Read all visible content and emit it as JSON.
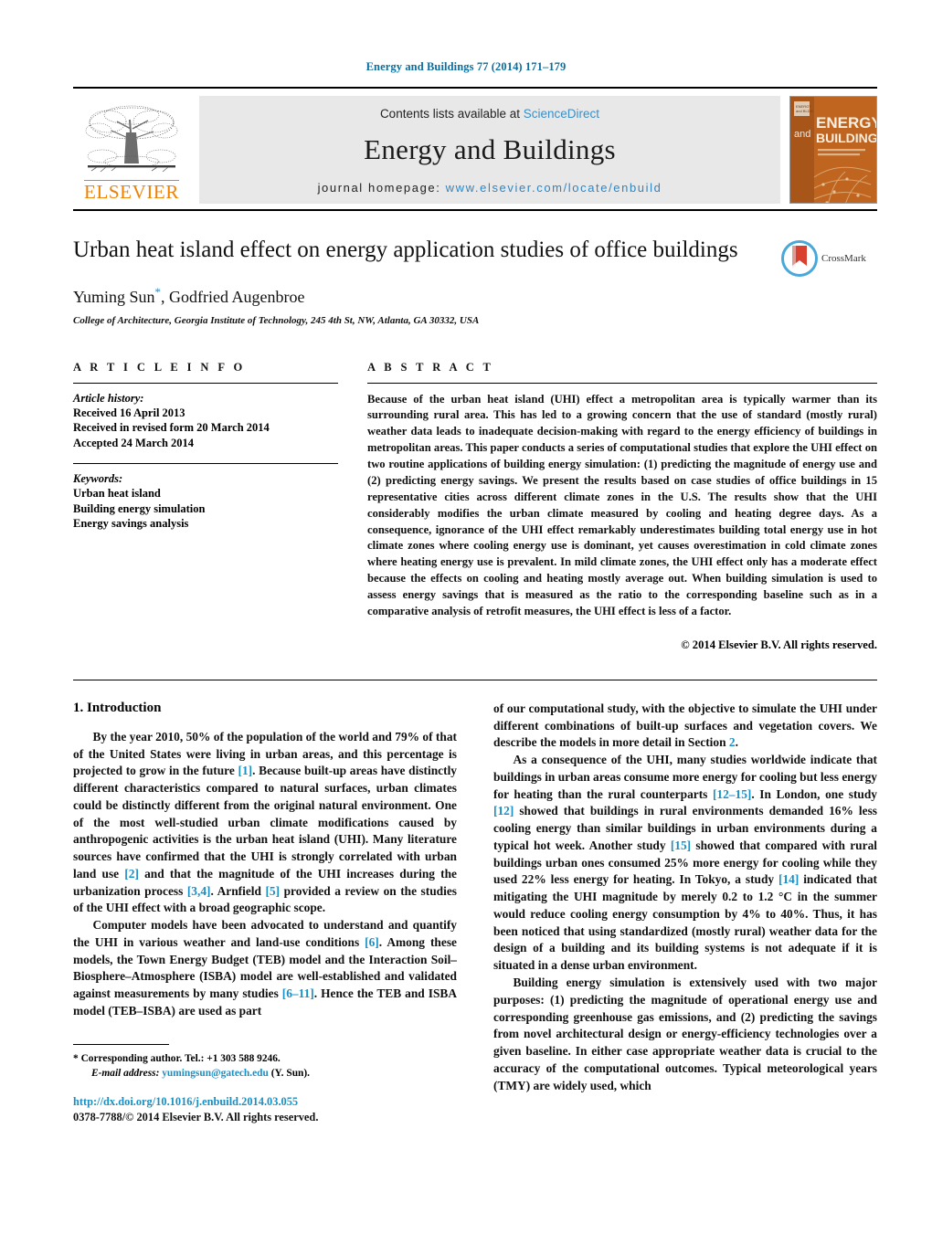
{
  "running_head": "Energy and Buildings 77 (2014) 171–179",
  "masthead": {
    "publisher_name": "ELSEVIER",
    "contents_prefix": "Contents lists available at ",
    "contents_link": "ScienceDirect",
    "journal_name": "Energy and Buildings",
    "homepage_prefix": "journal homepage: ",
    "homepage_url": "www.elsevier.com/locate/enbuild",
    "cover": {
      "line_and": "and",
      "line_energy": "ENERGY",
      "line_buildings": "BUILDINGS"
    },
    "accent_link_color": "#3a8fc7",
    "elsevier_orange": "#f08000",
    "cover_color": "#c0651f"
  },
  "article": {
    "title": "Urban heat island effect on energy application studies of office buildings",
    "authors": "Yuming Sun",
    "authors_rest": ", Godfried Augenbroe",
    "corresponding_marker": "*",
    "affiliation": "College of Architecture, Georgia Institute of Technology, 245 4th St, NW, Atlanta, GA 30332, USA",
    "crossmark_label": "CrossMark"
  },
  "article_info": {
    "heading": "A R T I C L E    I N F O",
    "history_label": "Article history:",
    "history": [
      "Received 16 April 2013",
      "Received in revised form 20 March 2014",
      "Accepted 24 March 2014"
    ],
    "keywords_label": "Keywords:",
    "keywords": [
      "Urban heat island",
      "Building energy simulation",
      "Energy savings analysis"
    ]
  },
  "abstract": {
    "heading": "A B S T R A C T",
    "text": "Because of the urban heat island (UHI) effect a metropolitan area is typically warmer than its surrounding rural area. This has led to a growing concern that the use of standard (mostly rural) weather data leads to inadequate decision-making with regard to the energy efficiency of buildings in metropolitan areas. This paper conducts a series of computational studies that explore the UHI effect on two routine applications of building energy simulation: (1) predicting the magnitude of energy use and (2) predicting energy savings. We present the results based on case studies of office buildings in 15 representative cities across different climate zones in the U.S. The results show that the UHI considerably modifies the urban climate measured by cooling and heating degree days. As a consequence, ignorance of the UHI effect remarkably underestimates building total energy use in hot climate zones where cooling energy use is dominant, yet causes overestimation in cold climate zones where heating energy use is prevalent. In mild climate zones, the UHI effect only has a moderate effect because the effects on cooling and heating mostly average out. When building simulation is used to assess energy savings that is measured as the ratio to the corresponding baseline such as in a comparative analysis of retrofit measures, the UHI effect is less of a factor.",
    "copyright": "© 2014 Elsevier B.V. All rights reserved."
  },
  "introduction": {
    "section_title": "1.  Introduction",
    "left_paragraphs": [
      "By the year 2010, 50% of the population of the world and 79% of that of the United States were living in urban areas, and this percentage is projected to grow in the future [1]. Because built-up areas have distinctly different characteristics compared to natural surfaces, urban climates could be distinctly different from the original natural environment. One of the most well-studied urban climate modifications caused by anthropogenic activities is the urban heat island (UHI). Many literature sources have confirmed that the UHI is strongly correlated with urban land use [2] and that the magnitude of the UHI increases during the urbanization process [3,4]. Arnfield [5] provided a review on the studies of the UHI effect with a broad geographic scope.",
      "Computer models have been advocated to understand and quantify the UHI in various weather and land-use conditions [6]. Among these models, the Town Energy Budget (TEB) model and the Interaction Soil–Biosphere–Atmosphere (ISBA) model are well-established and validated against measurements by many studies [6–11]. Hence the TEB and ISBA model (TEB–ISBA) are used as part"
    ],
    "right_paragraphs": [
      "of our computational study, with the objective to simulate the UHI under different combinations of built-up surfaces and vegetation covers. We describe the models in more detail in Section 2.",
      "As a consequence of the UHI, many studies worldwide indicate that buildings in urban areas consume more energy for cooling but less energy for heating than the rural counterparts [12–15]. In London, one study [12] showed that buildings in rural environments demanded 16% less cooling energy than similar buildings in urban environments during a typical hot week. Another study [15] showed that compared with rural buildings urban ones consumed 25% more energy for cooling while they used 22% less energy for heating. In Tokyo, a study [14] indicated that mitigating the UHI magnitude by merely 0.2 to 1.2 °C in the summer would reduce cooling energy consumption by 4% to 40%. Thus, it has been noticed that using standardized (mostly rural) weather data for the design of a building and its building systems is not adequate if it is situated in a dense urban environment.",
      "Building energy simulation is extensively used with two major purposes: (1) predicting the magnitude of operational energy use and corresponding greenhouse gas emissions, and (2) predicting the savings from novel architectural design or energy-efficiency technologies over a given baseline. In either case appropriate weather data is crucial to the accuracy of the computational outcomes. Typical meteorological years (TMY) are widely used, which"
    ]
  },
  "footnote": {
    "corresponding_marker": "*",
    "corresponding_text": "Corresponding author. Tel.: +1 303 588 9246.",
    "email_label": "E-mail address:",
    "email": "yumingsun@gatech.edu",
    "email_suffix": "(Y. Sun)."
  },
  "footer": {
    "doi": "http://dx.doi.org/10.1016/j.enbuild.2014.03.055",
    "issn": "0378-7788/© 2014 Elsevier B.V. All rights reserved."
  }
}
